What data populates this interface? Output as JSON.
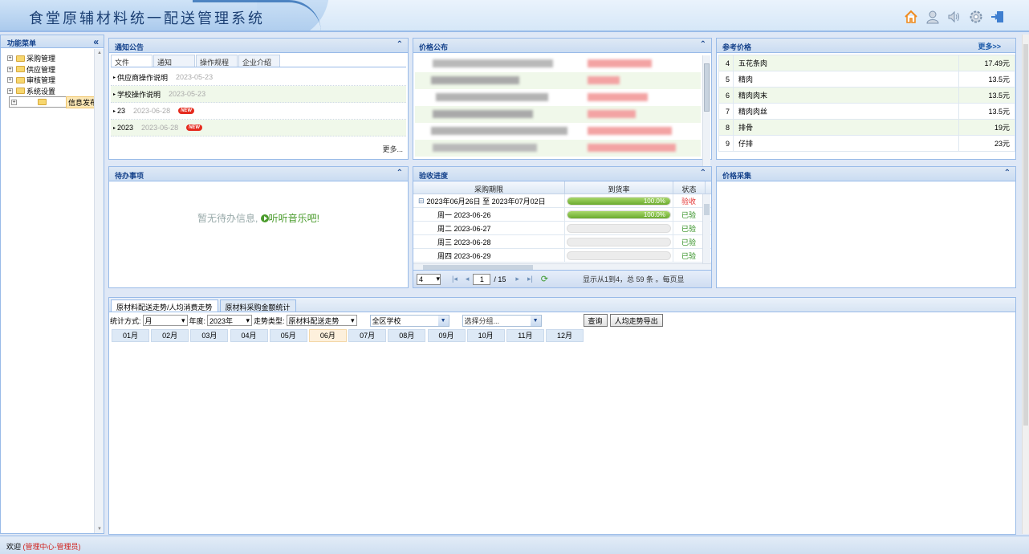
{
  "app": {
    "title": "食堂原辅材料统一配送管理系统"
  },
  "header_icons": [
    "home-icon",
    "user-icon",
    "speaker-icon",
    "settings-gear-icon",
    "logout-door-icon"
  ],
  "sidebar": {
    "title": "功能菜单",
    "collapse_glyph": "«",
    "items": [
      {
        "label": "采购管理",
        "selected": false
      },
      {
        "label": "供应管理",
        "selected": false
      },
      {
        "label": "审核管理",
        "selected": false
      },
      {
        "label": "系统设置",
        "selected": false
      },
      {
        "label": "信息发布",
        "selected": true
      }
    ]
  },
  "notice": {
    "title": "通知公告",
    "tabs": [
      "文件",
      "通知",
      "操作规程",
      "企业介绍"
    ],
    "rows": [
      {
        "title": "供应商操作说明",
        "date": "2023-05-23",
        "is_new": false
      },
      {
        "title": "学校操作说明",
        "date": "2023-05-23",
        "is_new": false
      },
      {
        "title": "23",
        "date": "2023-06-28",
        "is_new": true
      },
      {
        "title": "2023",
        "date": "2023-06-28",
        "is_new": true
      }
    ],
    "new_label": "NEW",
    "more": "更多..."
  },
  "price_publish": {
    "title": "价格公布"
  },
  "ref_price": {
    "title": "参考价格",
    "more": "更多>>",
    "rows": [
      {
        "no": "4",
        "name": "五花条肉",
        "price": "17.49元"
      },
      {
        "no": "5",
        "name": "精肉",
        "price": "13.5元"
      },
      {
        "no": "6",
        "name": "精肉肉末",
        "price": "13.5元"
      },
      {
        "no": "7",
        "name": "精肉肉丝",
        "price": "13.5元"
      },
      {
        "no": "8",
        "name": "排骨",
        "price": "19元"
      },
      {
        "no": "9",
        "name": "仔排",
        "price": "23元"
      }
    ]
  },
  "todo": {
    "title": "待办事项",
    "empty_text": "暂无待办信息,",
    "music_text": "听听音乐吧!"
  },
  "inspection": {
    "title": "验收进度",
    "columns": [
      "采购期限",
      "到货率",
      "状态"
    ],
    "rows": [
      {
        "period": "2023年06月26日 至 2023年07月02日",
        "rate_text": "100.0%",
        "rate": 1.0,
        "status": "验收",
        "status_color": "#e33333",
        "group": true
      },
      {
        "period": "周一 2023-06-26",
        "rate_text": "100.0%",
        "rate": 1.0,
        "status": "已验",
        "status_color": "#2f8f1f",
        "group": false
      },
      {
        "period": "周二 2023-06-27",
        "rate_text": "",
        "rate": 0,
        "status": "已验",
        "status_color": "#2f8f1f",
        "group": false
      },
      {
        "period": "周三 2023-06-28",
        "rate_text": "",
        "rate": 0,
        "status": "已验",
        "status_color": "#2f8f1f",
        "group": false
      },
      {
        "period": "周四 2023-06-29",
        "rate_text": "",
        "rate": 0,
        "status": "已验",
        "status_color": "#2f8f1f",
        "group": false
      }
    ],
    "pager": {
      "page_size": "4",
      "page": "1",
      "total_pages": "/ 15",
      "summary": "显示从1到4，总 59 条 。每页显"
    }
  },
  "price_collect": {
    "title": "价格采集"
  },
  "trend": {
    "tabs": [
      "原材料配送走势/人均消费走势",
      "原材料采购金额统计"
    ],
    "filters": {
      "stat_label": "统计方式:",
      "stat_value": "月",
      "year_label": "年度:",
      "year_value": "2023年",
      "type_label": "走势类型:",
      "type_value": "原材料配送走势",
      "school_value": "全区学校",
      "group_placeholder": "选择分组..."
    },
    "buttons": {
      "query": "查询",
      "export": "人均走势导出"
    },
    "months": [
      "01月",
      "02月",
      "03月",
      "04月",
      "05月",
      "06月",
      "07月",
      "08月",
      "09月",
      "10月",
      "11月",
      "12月"
    ],
    "active_month": "06月"
  },
  "footer": {
    "welcome": "欢迎",
    "user": "(管理中心-管理员)"
  }
}
